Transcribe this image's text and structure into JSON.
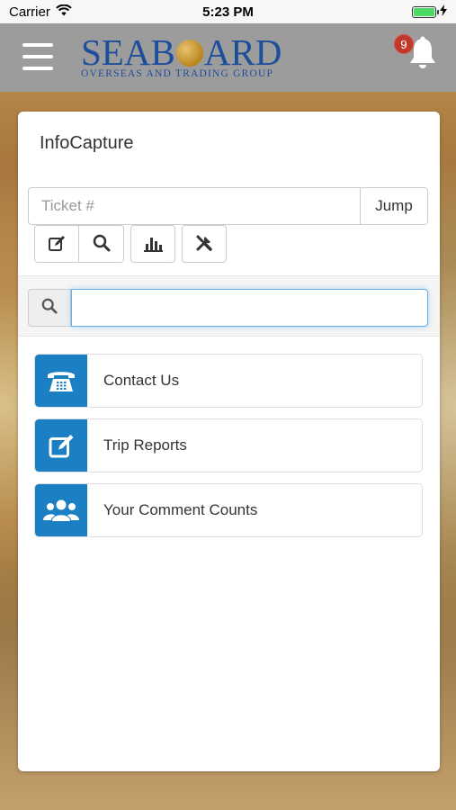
{
  "status_bar": {
    "carrier": "Carrier",
    "time": "5:23 PM"
  },
  "header": {
    "brand": "SEABOARD",
    "brand_pre": "SEAB",
    "brand_post": "ARD",
    "tagline": "OVERSEAS AND TRADING GROUP",
    "notification_count": "9"
  },
  "card": {
    "title": "InfoCapture",
    "ticket_placeholder": "Ticket #",
    "jump_label": "Jump",
    "search_value": ""
  },
  "tools": [
    "edit-icon",
    "search-icon",
    "bar-chart-icon",
    "tools-icon"
  ],
  "menu": [
    {
      "label": "Contact Us",
      "icon": "phone-icon"
    },
    {
      "label": "Trip Reports",
      "icon": "edit-icon"
    },
    {
      "label": "Your Comment Counts",
      "icon": "users-icon"
    }
  ],
  "colors": {
    "accent": "#1b7fc4",
    "header_bg": "#9c9c9c",
    "brand_blue": "#1d4e9c",
    "badge": "#c0392b"
  }
}
